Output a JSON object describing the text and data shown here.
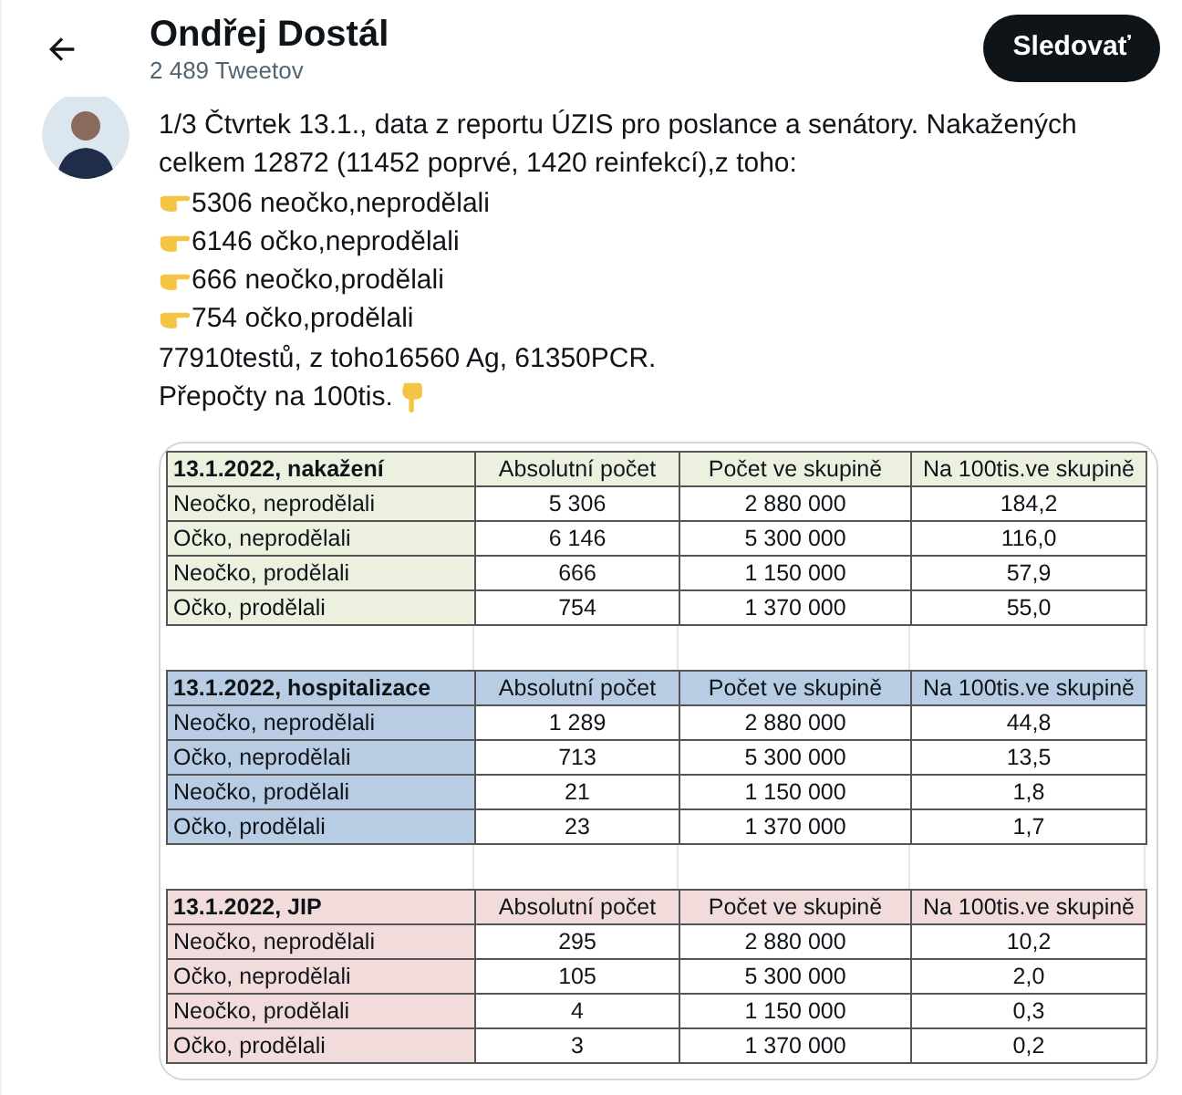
{
  "header": {
    "title": "Ondřej Dostál",
    "subtitle": "2 489 Tweetov",
    "follow_button": "Sledovať"
  },
  "tweet": {
    "lines": [
      {
        "kind": "plain",
        "text": "1/3 Čtvrtek 13.1., data z reportu ÚZIS pro poslance a senátory. Nakažených"
      },
      {
        "kind": "plain",
        "text": "celkem 12872 (11452 poprvé, 1420 reinfekcí),z toho:"
      },
      {
        "kind": "bullet",
        "text": "5306 neočko,neprodělali"
      },
      {
        "kind": "bullet",
        "text": "6146 očko,neprodělali"
      },
      {
        "kind": "bullet",
        "text": "666 neočko,prodělali"
      },
      {
        "kind": "bullet",
        "text": "754 očko,prodělali"
      },
      {
        "kind": "plain",
        "text": "77910testů, z toho16560 Ag, 61350PCR."
      },
      {
        "kind": "pointer",
        "text": "Přepočty na 100tis."
      }
    ]
  },
  "tables": [
    {
      "color": "#ebf1de",
      "columns": [
        "13.1.2022, nakažení",
        "Absolutní počet",
        "Počet ve skupině",
        "Na 100tis.ve skupině"
      ],
      "rows": [
        [
          "Neočko, neprodělali",
          "5 306",
          "2 880 000",
          "184,2"
        ],
        [
          "Očko, neprodělali",
          "6 146",
          "5 300 000",
          "116,0"
        ],
        [
          "Neočko, prodělali",
          "666",
          "1 150 000",
          "57,9"
        ],
        [
          "Očko, prodělali",
          "754",
          "1 370 000",
          "55,0"
        ]
      ]
    },
    {
      "color": "#b8cce4",
      "columns": [
        "13.1.2022, hospitalizace",
        "Absolutní počet",
        "Počet ve skupině",
        "Na 100tis.ve skupině"
      ],
      "rows": [
        [
          "Neočko, neprodělali",
          "1 289",
          "2 880 000",
          "44,8"
        ],
        [
          "Očko, neprodělali",
          "713",
          "5 300 000",
          "13,5"
        ],
        [
          "Neočko, prodělali",
          "21",
          "1 150 000",
          "1,8"
        ],
        [
          "Očko, prodělali",
          "23",
          "1 370 000",
          "1,7"
        ]
      ]
    },
    {
      "color": "#f2dcdb",
      "columns": [
        "13.1.2022, JIP",
        "Absolutní počet",
        "Počet ve skupině",
        "Na 100tis.ve skupině"
      ],
      "rows": [
        [
          "Neočko, neprodělali",
          "295",
          "2 880 000",
          "10,2"
        ],
        [
          "Očko, neprodělali",
          "105",
          "5 300 000",
          "2,0"
        ],
        [
          "Neočko, prodělali",
          "4",
          "1 150 000",
          "0,3"
        ],
        [
          "Očko, prodělali",
          "3",
          "1 370 000",
          "0,2"
        ]
      ]
    }
  ]
}
